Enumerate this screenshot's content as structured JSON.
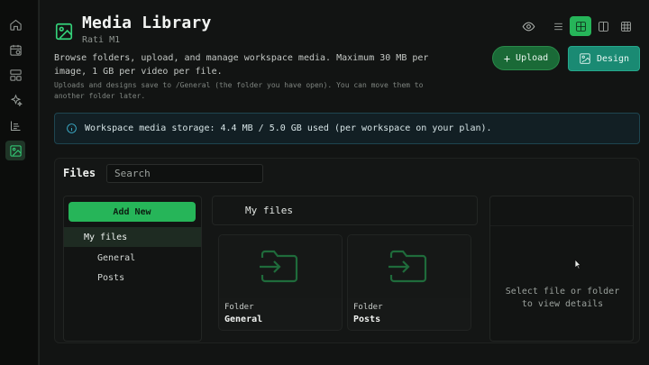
{
  "rail": {
    "items": [
      {
        "icon": "home-icon"
      },
      {
        "icon": "calendar-icon"
      },
      {
        "icon": "layout-icon"
      },
      {
        "icon": "sparkles-icon"
      },
      {
        "icon": "analytics-icon"
      },
      {
        "icon": "media-icon",
        "active": true
      }
    ]
  },
  "header": {
    "title": "Media Library",
    "workspace": "Rati M1",
    "description": "Browse folders, upload, and manage workspace media. Maximum 30 MB per image, 1 GB per video per file.",
    "note": "Uploads and designs save to /General (the folder you have open). You can move them to another folder later."
  },
  "toolbar": {
    "upload_label": "Upload",
    "design_label": "Design",
    "views": [
      "list-view-icon",
      "grid-view-icon",
      "split-view-icon",
      "table-view-icon"
    ],
    "active_view": "grid-view-icon"
  },
  "storage": {
    "text": "Workspace media storage: 4.4 MB / 5.0 GB used (per workspace on your plan)."
  },
  "files": {
    "title": "Files",
    "search_placeholder": "Search",
    "add_new_label": "Add New",
    "tree": [
      {
        "label": "My files",
        "level": 0,
        "selected": true
      },
      {
        "label": "General",
        "level": 1
      },
      {
        "label": "Posts",
        "level": 1
      }
    ],
    "current_path": "My files",
    "items": [
      {
        "kind": "Folder",
        "name": "General"
      },
      {
        "kind": "Folder",
        "name": "Posts"
      }
    ],
    "details_empty": "Select file or folder to view details"
  },
  "colors": {
    "accent": "#26b559",
    "design": "#1a8a73",
    "info": "#3fb8d6"
  }
}
